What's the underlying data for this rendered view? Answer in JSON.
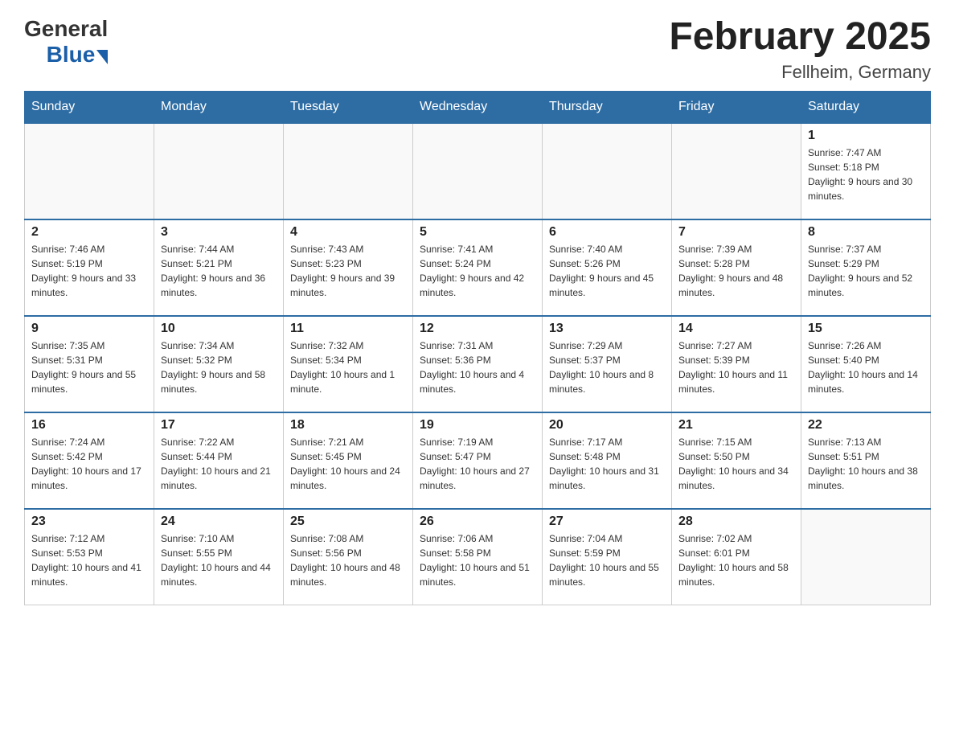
{
  "header": {
    "logo_general": "General",
    "logo_blue": "Blue",
    "month_title": "February 2025",
    "location": "Fellheim, Germany"
  },
  "weekdays": [
    "Sunday",
    "Monday",
    "Tuesday",
    "Wednesday",
    "Thursday",
    "Friday",
    "Saturday"
  ],
  "weeks": [
    [
      {
        "day": "",
        "info": ""
      },
      {
        "day": "",
        "info": ""
      },
      {
        "day": "",
        "info": ""
      },
      {
        "day": "",
        "info": ""
      },
      {
        "day": "",
        "info": ""
      },
      {
        "day": "",
        "info": ""
      },
      {
        "day": "1",
        "info": "Sunrise: 7:47 AM\nSunset: 5:18 PM\nDaylight: 9 hours and 30 minutes."
      }
    ],
    [
      {
        "day": "2",
        "info": "Sunrise: 7:46 AM\nSunset: 5:19 PM\nDaylight: 9 hours and 33 minutes."
      },
      {
        "day": "3",
        "info": "Sunrise: 7:44 AM\nSunset: 5:21 PM\nDaylight: 9 hours and 36 minutes."
      },
      {
        "day": "4",
        "info": "Sunrise: 7:43 AM\nSunset: 5:23 PM\nDaylight: 9 hours and 39 minutes."
      },
      {
        "day": "5",
        "info": "Sunrise: 7:41 AM\nSunset: 5:24 PM\nDaylight: 9 hours and 42 minutes."
      },
      {
        "day": "6",
        "info": "Sunrise: 7:40 AM\nSunset: 5:26 PM\nDaylight: 9 hours and 45 minutes."
      },
      {
        "day": "7",
        "info": "Sunrise: 7:39 AM\nSunset: 5:28 PM\nDaylight: 9 hours and 48 minutes."
      },
      {
        "day": "8",
        "info": "Sunrise: 7:37 AM\nSunset: 5:29 PM\nDaylight: 9 hours and 52 minutes."
      }
    ],
    [
      {
        "day": "9",
        "info": "Sunrise: 7:35 AM\nSunset: 5:31 PM\nDaylight: 9 hours and 55 minutes."
      },
      {
        "day": "10",
        "info": "Sunrise: 7:34 AM\nSunset: 5:32 PM\nDaylight: 9 hours and 58 minutes."
      },
      {
        "day": "11",
        "info": "Sunrise: 7:32 AM\nSunset: 5:34 PM\nDaylight: 10 hours and 1 minute."
      },
      {
        "day": "12",
        "info": "Sunrise: 7:31 AM\nSunset: 5:36 PM\nDaylight: 10 hours and 4 minutes."
      },
      {
        "day": "13",
        "info": "Sunrise: 7:29 AM\nSunset: 5:37 PM\nDaylight: 10 hours and 8 minutes."
      },
      {
        "day": "14",
        "info": "Sunrise: 7:27 AM\nSunset: 5:39 PM\nDaylight: 10 hours and 11 minutes."
      },
      {
        "day": "15",
        "info": "Sunrise: 7:26 AM\nSunset: 5:40 PM\nDaylight: 10 hours and 14 minutes."
      }
    ],
    [
      {
        "day": "16",
        "info": "Sunrise: 7:24 AM\nSunset: 5:42 PM\nDaylight: 10 hours and 17 minutes."
      },
      {
        "day": "17",
        "info": "Sunrise: 7:22 AM\nSunset: 5:44 PM\nDaylight: 10 hours and 21 minutes."
      },
      {
        "day": "18",
        "info": "Sunrise: 7:21 AM\nSunset: 5:45 PM\nDaylight: 10 hours and 24 minutes."
      },
      {
        "day": "19",
        "info": "Sunrise: 7:19 AM\nSunset: 5:47 PM\nDaylight: 10 hours and 27 minutes."
      },
      {
        "day": "20",
        "info": "Sunrise: 7:17 AM\nSunset: 5:48 PM\nDaylight: 10 hours and 31 minutes."
      },
      {
        "day": "21",
        "info": "Sunrise: 7:15 AM\nSunset: 5:50 PM\nDaylight: 10 hours and 34 minutes."
      },
      {
        "day": "22",
        "info": "Sunrise: 7:13 AM\nSunset: 5:51 PM\nDaylight: 10 hours and 38 minutes."
      }
    ],
    [
      {
        "day": "23",
        "info": "Sunrise: 7:12 AM\nSunset: 5:53 PM\nDaylight: 10 hours and 41 minutes."
      },
      {
        "day": "24",
        "info": "Sunrise: 7:10 AM\nSunset: 5:55 PM\nDaylight: 10 hours and 44 minutes."
      },
      {
        "day": "25",
        "info": "Sunrise: 7:08 AM\nSunset: 5:56 PM\nDaylight: 10 hours and 48 minutes."
      },
      {
        "day": "26",
        "info": "Sunrise: 7:06 AM\nSunset: 5:58 PM\nDaylight: 10 hours and 51 minutes."
      },
      {
        "day": "27",
        "info": "Sunrise: 7:04 AM\nSunset: 5:59 PM\nDaylight: 10 hours and 55 minutes."
      },
      {
        "day": "28",
        "info": "Sunrise: 7:02 AM\nSunset: 6:01 PM\nDaylight: 10 hours and 58 minutes."
      },
      {
        "day": "",
        "info": ""
      }
    ]
  ]
}
